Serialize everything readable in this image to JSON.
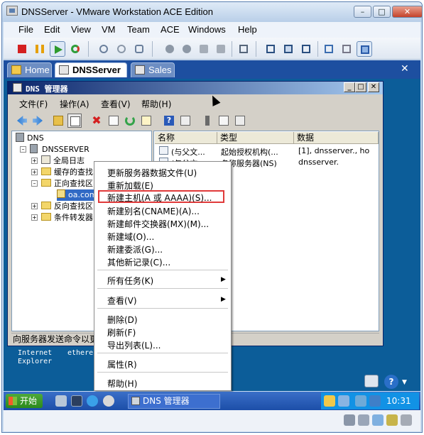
{
  "window": {
    "title": "DNSServer - VMware Workstation ACE Edition"
  },
  "menubar": [
    "File",
    "Edit",
    "View",
    "VM",
    "Team",
    "ACE",
    "Windows",
    "Help"
  ],
  "tabs": [
    {
      "label": "Home",
      "active": false
    },
    {
      "label": "DNSServer",
      "active": true
    },
    {
      "label": "Sales",
      "active": false
    }
  ],
  "dns_window": {
    "title": "DNS 管理器",
    "menu": [
      "文件(F)",
      "操作(A)",
      "查看(V)",
      "帮助(H)"
    ],
    "tree": {
      "root": "DNS",
      "server": "DNSSERVER",
      "nodes": [
        "全局日志",
        "缓存的查找",
        "正向查找区",
        "oa.com",
        "反向查找区",
        "条件转发器"
      ]
    },
    "list": {
      "headers": [
        "名称",
        "类型",
        "数据"
      ],
      "rows": [
        {
          "name": "(与父文...",
          "type": "起始授权机构(...",
          "data": "[1], dnsserver., ho"
        },
        {
          "name": "(与父文...",
          "type": "名称服务器(NS)",
          "data": "dnsserver."
        }
      ]
    },
    "status": "向服务器发送命令以更"
  },
  "context_menu": {
    "items": [
      "更新服务器数据文件(U)",
      "重新加载(E)",
      "新建主机(A 或 AAAA)(S)...",
      "新建别名(CNAME)(A)...",
      "新建邮件交换器(MX)(M)...",
      "新建域(O)...",
      "新建委派(G)...",
      "其他新记录(C)...",
      "所有任务(K)",
      "查看(V)",
      "删除(D)",
      "刷新(F)",
      "导出列表(L)...",
      "属性(R)",
      "帮助(H)"
    ],
    "highlighted": "新建主机(A 或 AAAA)(S)..."
  },
  "desktop_text": [
    "Internet",
    "Explorer",
    "ethere"
  ],
  "taskbar": {
    "start_label": "开始",
    "task_label": "DNS 管理器",
    "clock": "10:31"
  },
  "colors": {
    "vm_tabbar": "#1d4fa0",
    "guest_desktop": "#0c5d99",
    "highlight_box": "#e03a3a",
    "title_gradient_start": "#0a246a"
  }
}
